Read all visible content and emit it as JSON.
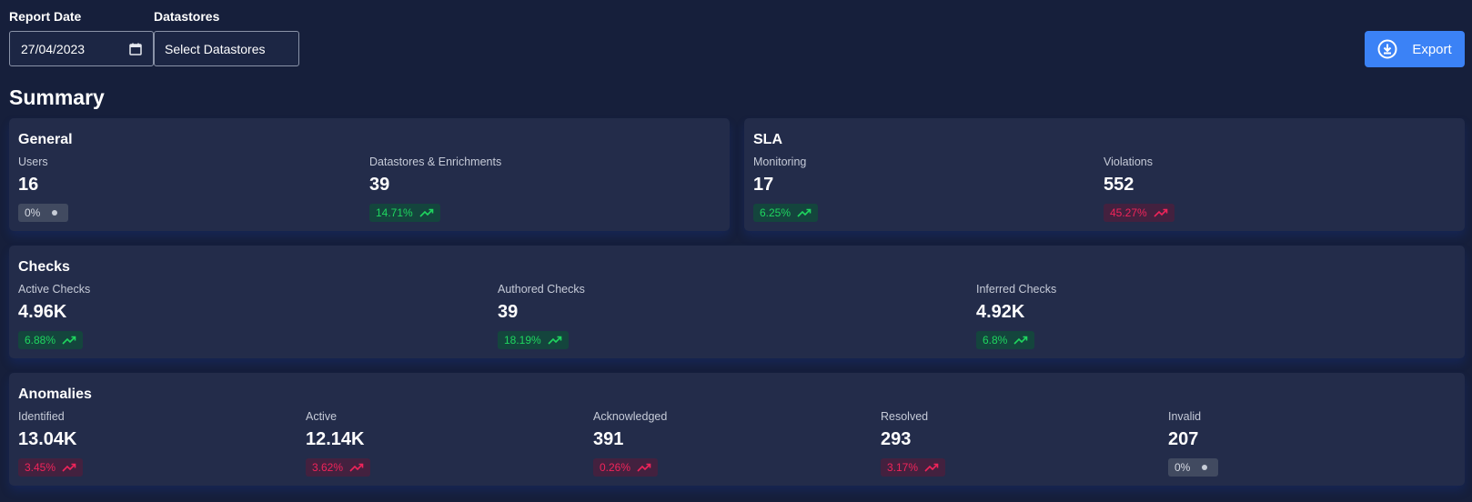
{
  "filters": {
    "report_date_label": "Report Date",
    "report_date_value": "27/04/2023",
    "datastores_label": "Datastores",
    "datastores_value": "Select Datastores"
  },
  "export_label": "Export",
  "summary_title": "Summary",
  "colors": {
    "background": "#161f3b",
    "card": "#232c4a",
    "accent": "#3b82f6",
    "positive": "#1fd65f",
    "negative": "#f0245a",
    "neutral": "#d5d9e2"
  },
  "general": {
    "title": "General",
    "users": {
      "label": "Users",
      "value": "16",
      "change": "0%",
      "trend": "neutral"
    },
    "datastores": {
      "label": "Datastores & Enrichments",
      "value": "39",
      "change": "14.71%",
      "trend": "up"
    }
  },
  "sla": {
    "title": "SLA",
    "monitoring": {
      "label": "Monitoring",
      "value": "17",
      "change": "6.25%",
      "trend": "up"
    },
    "violations": {
      "label": "Violations",
      "value": "552",
      "change": "45.27%",
      "trend": "down"
    }
  },
  "checks": {
    "title": "Checks",
    "active": {
      "label": "Active Checks",
      "value": "4.96K",
      "change": "6.88%",
      "trend": "up"
    },
    "authored": {
      "label": "Authored Checks",
      "value": "39",
      "change": "18.19%",
      "trend": "up"
    },
    "inferred": {
      "label": "Inferred Checks",
      "value": "4.92K",
      "change": "6.8%",
      "trend": "up"
    }
  },
  "anomalies": {
    "title": "Anomalies",
    "identified": {
      "label": "Identified",
      "value": "13.04K",
      "change": "3.45%",
      "trend": "down"
    },
    "active": {
      "label": "Active",
      "value": "12.14K",
      "change": "3.62%",
      "trend": "down"
    },
    "acknowledged": {
      "label": "Acknowledged",
      "value": "391",
      "change": "0.26%",
      "trend": "down"
    },
    "resolved": {
      "label": "Resolved",
      "value": "293",
      "change": "3.17%",
      "trend": "down"
    },
    "invalid": {
      "label": "Invalid",
      "value": "207",
      "change": "0%",
      "trend": "neutral"
    }
  },
  "icons": {
    "calendar": "calendar-icon",
    "export": "download-circle-icon",
    "trend_up": "trending-up-icon",
    "neutral": "dot-icon"
  }
}
